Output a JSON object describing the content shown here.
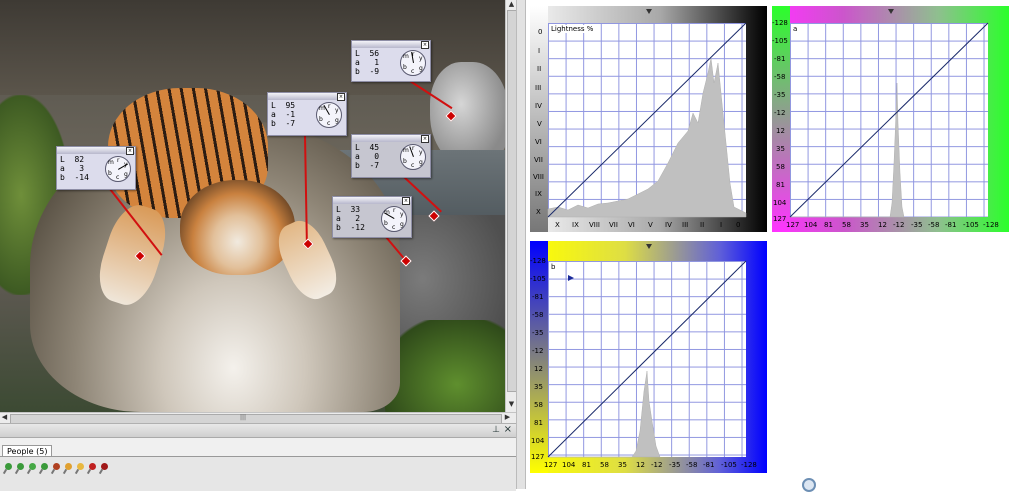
{
  "probes": [
    {
      "id": "p1",
      "L": "82",
      "a": "3",
      "b": "-14",
      "labels": [
        "L",
        "a",
        "b"
      ]
    },
    {
      "id": "p2",
      "L": "95",
      "a": "-1",
      "b": "-7",
      "labels": [
        "L",
        "a",
        "b"
      ]
    },
    {
      "id": "p3",
      "L": "56",
      "a": "1",
      "b": "-9",
      "labels": [
        "L",
        "a",
        "b"
      ]
    },
    {
      "id": "p4",
      "L": "45",
      "a": "0",
      "b": "-7",
      "labels": [
        "L",
        "a",
        "b"
      ]
    },
    {
      "id": "p5",
      "L": "33",
      "a": "2",
      "b": "-12",
      "labels": [
        "L",
        "a",
        "b"
      ]
    }
  ],
  "dial_letters": {
    "m": "m",
    "r": "r",
    "y": "y",
    "g": "g",
    "c": "c",
    "b": "b"
  },
  "panel": {
    "tab_label": "People (5)"
  },
  "curves": {
    "lightness": {
      "title": "Lightness %",
      "y_ticks": [
        "0",
        "I",
        "II",
        "III",
        "IV",
        "V",
        "VI",
        "VII",
        "VIII",
        "IX",
        "X"
      ],
      "x_ticks": [
        "X",
        "IX",
        "VIII",
        "VII",
        "VI",
        "V",
        "IV",
        "III",
        "II",
        "I",
        "0"
      ]
    },
    "a": {
      "title": "a",
      "y_ticks": [
        "-128",
        "-105",
        "-81",
        "-58",
        "-35",
        "-12",
        "12",
        "35",
        "58",
        "81",
        "104",
        "127"
      ],
      "x_ticks": [
        "127",
        "104",
        "81",
        "58",
        "35",
        "12",
        "-12",
        "-35",
        "-58",
        "-81",
        "-105",
        "-128"
      ]
    },
    "b": {
      "title": "b",
      "y_ticks": [
        "-128",
        "-105",
        "-81",
        "-58",
        "-35",
        "-12",
        "12",
        "35",
        "58",
        "81",
        "104",
        "127"
      ],
      "x_ticks": [
        "127",
        "104",
        "81",
        "58",
        "35",
        "12",
        "-12",
        "-35",
        "-58",
        "-81",
        "-105",
        "-128"
      ]
    }
  },
  "colors": {
    "leader": "#d11010",
    "grid": "#8f95e0",
    "histogram": "#c0c0c0"
  }
}
